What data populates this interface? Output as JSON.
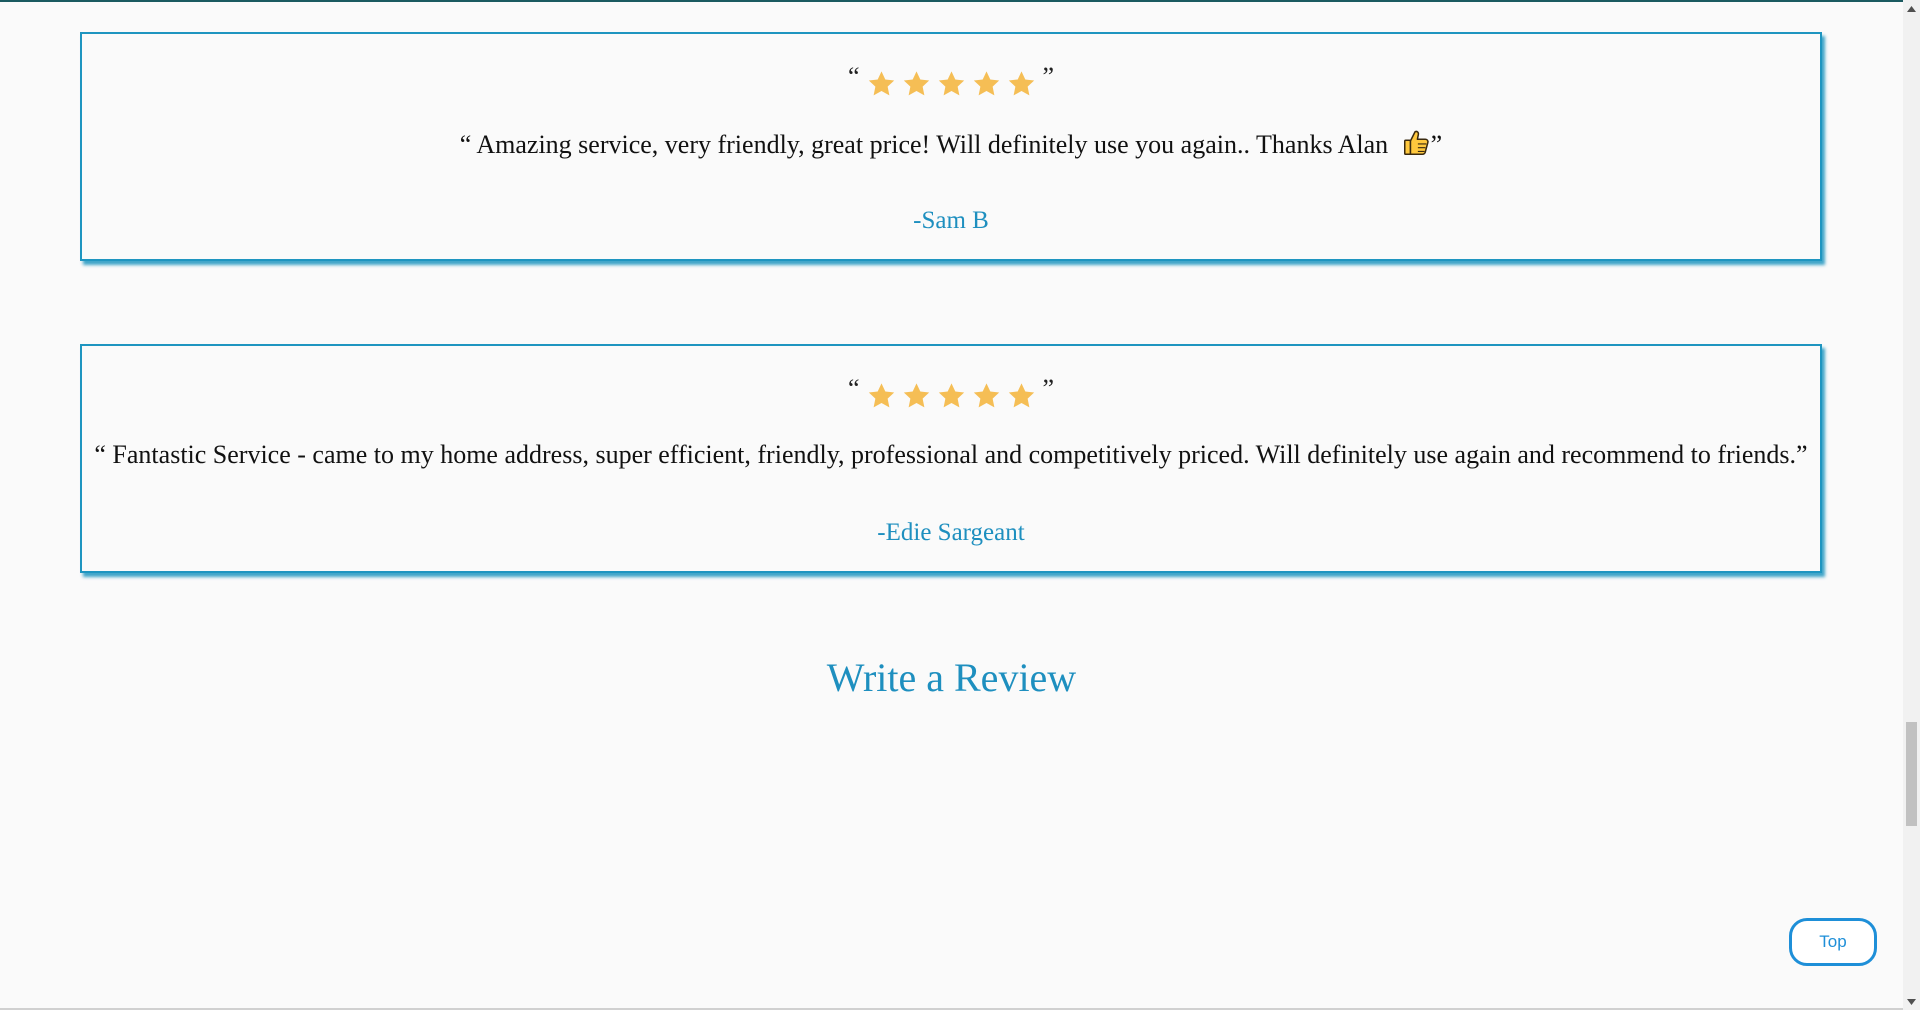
{
  "reviews": [
    {
      "rating": 5,
      "open_quote": "“",
      "close_quote": "”",
      "text": "“ Amazing service, very friendly, great price! Will definitely use you again.. Thanks Alan ",
      "text_end": "”",
      "emoji": "thumbs-up-icon",
      "author": "-Sam B"
    },
    {
      "rating": 5,
      "open_quote": "“",
      "close_quote": "”",
      "text": "“ Fantastic Service - came to my home address, super efficient, friendly, professional and competitively priced. Will definitely use again and recommend to friends.”",
      "author": "-Edie Sargeant"
    }
  ],
  "write_review": {
    "heading": "Write a Review"
  },
  "top_button": {
    "label": "Top"
  },
  "colors": {
    "accent": "#1e8fbf",
    "card_border": "#1e95c0",
    "star": "#f5be55",
    "button": "#1e8fd8",
    "background": "#fafafa"
  }
}
